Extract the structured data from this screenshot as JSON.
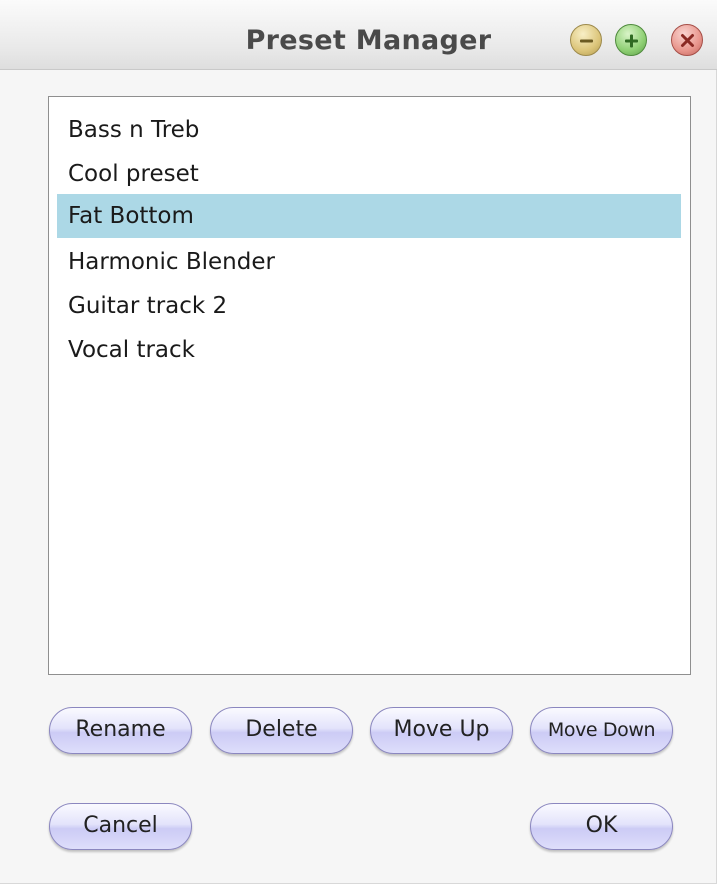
{
  "window": {
    "title": "Preset Manager",
    "controls": {
      "minimize_icon": "minus-icon",
      "maximize_icon": "plus-icon",
      "close_icon": "x-icon",
      "minimize_color": "#dcc57a",
      "maximize_color": "#8ecf73",
      "close_color": "#e8958c"
    }
  },
  "presets": {
    "items": [
      {
        "label": "Bass n Treb",
        "selected": false
      },
      {
        "label": "Cool preset",
        "selected": false
      },
      {
        "label": "Fat Bottom",
        "selected": true
      },
      {
        "label": "Harmonic Blender",
        "selected": false
      },
      {
        "label": "Guitar track 2",
        "selected": false
      },
      {
        "label": "Vocal track",
        "selected": false
      }
    ],
    "selection_color": "#acd8e6"
  },
  "actions": {
    "rename_label": "Rename",
    "delete_label": "Delete",
    "move_up_label": "Move Up",
    "move_down_label": "Move Down"
  },
  "footer": {
    "cancel_label": "Cancel",
    "ok_label": "OK"
  }
}
